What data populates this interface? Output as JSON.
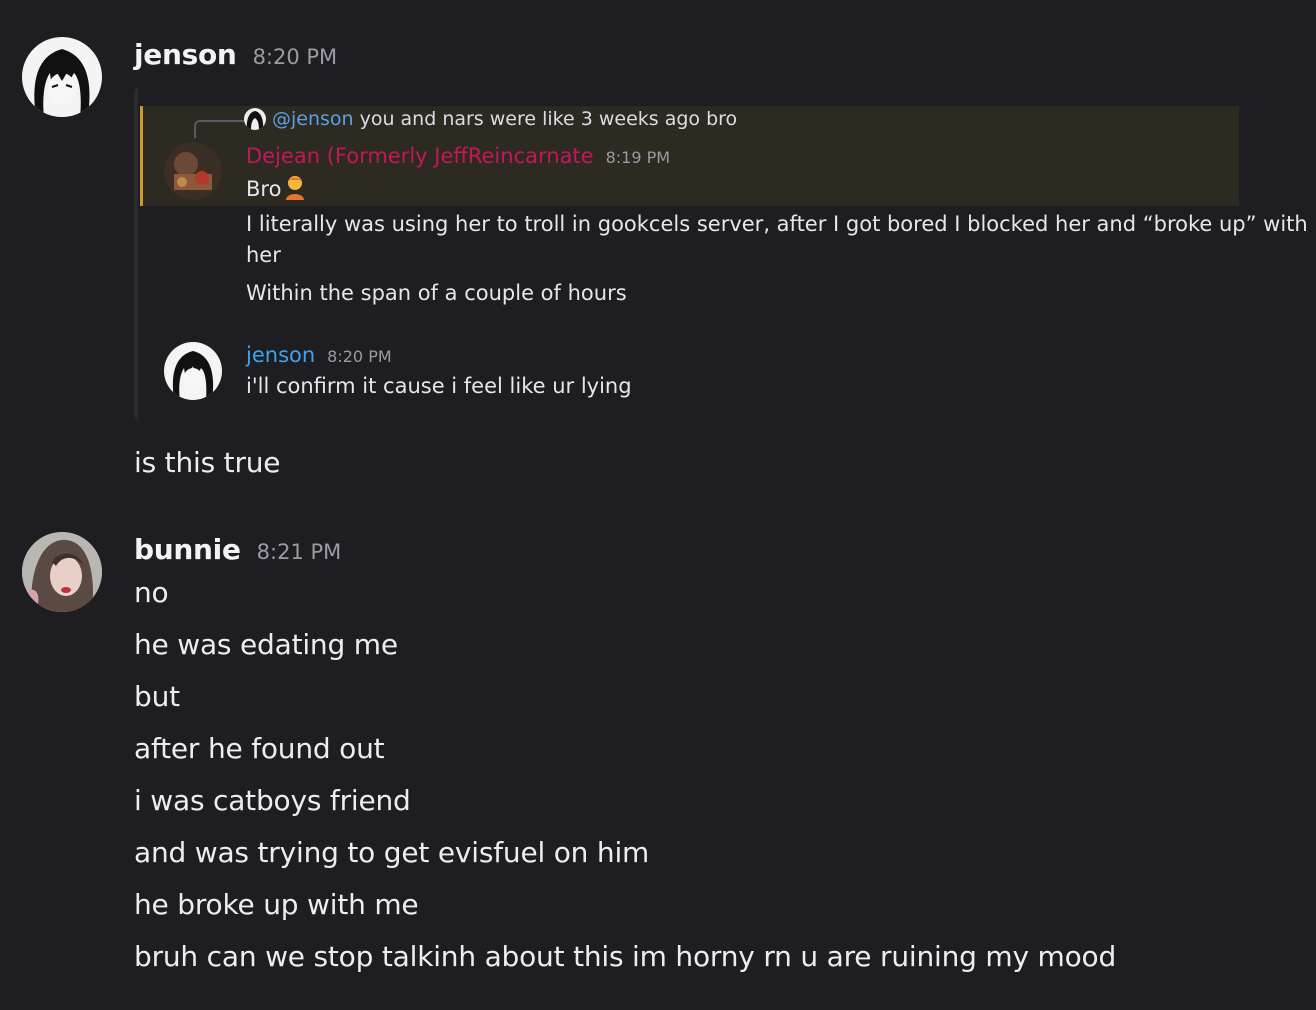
{
  "messages": [
    {
      "username": "jenson",
      "time": "8:20 PM",
      "embed": {
        "reply_mention": "@jenson",
        "reply_text": "you and nars were like 3 weeks ago bro",
        "first_author": "Dejean (Formerly JeffReincarnate",
        "first_time": "8:19 PM",
        "first_lines": [
          "Bro",
          "I literally was using her to troll in gookcels server, after I got bored I blocked her and “broke up” with",
          "her",
          "Within the span of a couple of hours"
        ],
        "second_author": "jenson",
        "second_time": "8:20 PM",
        "second_line": "i'll confirm it cause i feel like ur lying"
      },
      "text": "is this true"
    },
    {
      "username": "bunnie",
      "time": "8:21 PM",
      "lines": [
        "no",
        "he was edating me",
        "but",
        "after he found out",
        "i was catboys friend",
        "and was trying to get evisfuel on him",
        "he broke up with me",
        "bruh can we stop talkinh about this im horny rn u are ruining my mood"
      ]
    }
  ],
  "colors": {
    "background": "#1e1e22",
    "mention": "#5aa0e6",
    "dejean_name": "#c2185b",
    "jenson_name_embed": "#3ea2f0",
    "reply_highlight": "#2d2a22",
    "reply_bar": "#c99b2a"
  },
  "icons": {
    "jenson_avatar": "anime-girl-avatar",
    "bunnie_avatar": "selfie-avatar",
    "dejean_avatar": "photo-avatar",
    "emoji": "person-emoji"
  }
}
